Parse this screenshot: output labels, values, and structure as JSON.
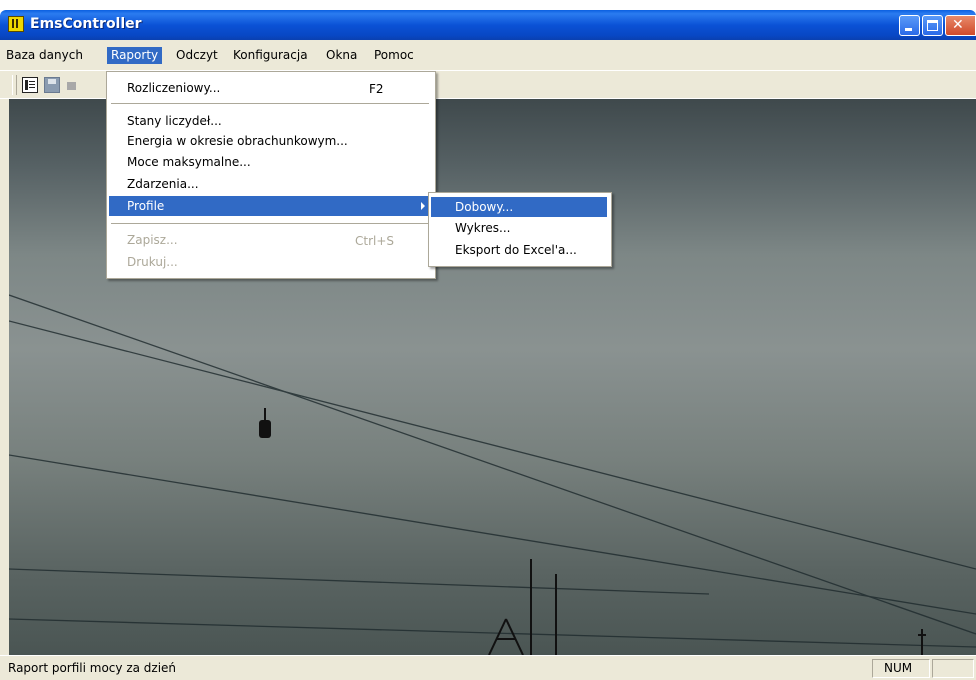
{
  "window": {
    "title": "EmsController"
  },
  "menubar": [
    "Baza danych",
    "Raporty",
    "Odczyt",
    "Konfiguracja",
    "Okna",
    "Pomoc"
  ],
  "raporty_menu": {
    "items": [
      {
        "label": "Rozliczeniowy...",
        "shortcut": "F2"
      },
      {
        "label": "Stany liczydeł..."
      },
      {
        "label": "Energia w okresie obrachunkowym..."
      },
      {
        "label": "Moce maksymalne..."
      },
      {
        "label": "Zdarzenia..."
      },
      {
        "label": "Profile"
      },
      {
        "label": "Zapisz...",
        "shortcut": "Ctrl+S",
        "disabled": true
      },
      {
        "label": "Drukuj...",
        "disabled": true
      }
    ]
  },
  "profile_submenu": [
    "Dobowy...",
    "Wykres...",
    "Eksport do Excel'a..."
  ],
  "statusbar": {
    "text": "Raport porfili mocy za dzień",
    "num": "NUM"
  }
}
